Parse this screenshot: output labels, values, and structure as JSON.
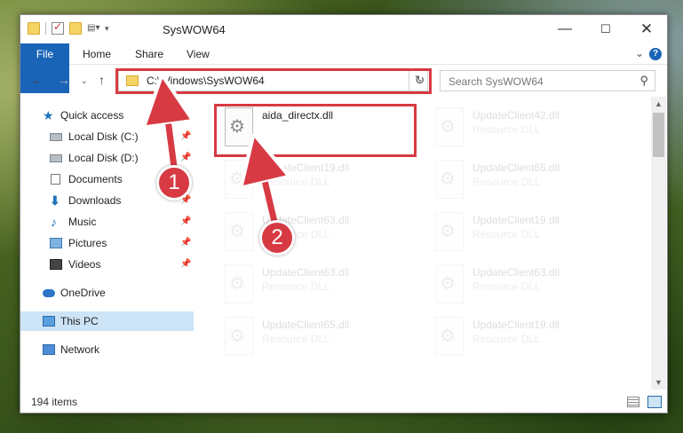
{
  "window": {
    "title": "SysWOW64",
    "minimize": "—",
    "maximize": "☐",
    "close": "✕"
  },
  "ribbon": {
    "tabs": [
      "File",
      "Home",
      "Share",
      "View"
    ],
    "expand": "⌄",
    "help": "?"
  },
  "address": {
    "path": "C:\\Windows\\SysWOW64",
    "dropdown": "⌄",
    "refresh": "↻"
  },
  "search": {
    "placeholder": "Search SysWOW64",
    "icon": "search-icon"
  },
  "nav_buttons": {
    "back": "←",
    "forward": "→",
    "recent": "⌄",
    "up": "↑"
  },
  "sidebar": {
    "items": [
      {
        "label": "Quick access",
        "icon": "star-icon"
      },
      {
        "label": "Local Disk (C:)",
        "icon": "drive-icon",
        "pinned": true
      },
      {
        "label": "Local Disk (D:)",
        "icon": "drive-icon",
        "pinned": true
      },
      {
        "label": "Documents",
        "icon": "documents-icon",
        "pinned": true
      },
      {
        "label": "Downloads",
        "icon": "downloads-icon",
        "pinned": true
      },
      {
        "label": "Music",
        "icon": "music-icon",
        "pinned": true
      },
      {
        "label": "Pictures",
        "icon": "pictures-icon",
        "pinned": true
      },
      {
        "label": "Videos",
        "icon": "videos-icon",
        "pinned": true
      },
      {
        "label": "OneDrive",
        "icon": "onedrive-icon"
      },
      {
        "label": "This PC",
        "icon": "pc-icon",
        "selected": true
      },
      {
        "label": "Network",
        "icon": "network-icon"
      }
    ],
    "pin_glyph": "📌"
  },
  "files": [
    {
      "name": "aida_directx.dll",
      "type": ""
    },
    {
      "name": "UpdateClient42.dll",
      "type": "Resource DLL"
    },
    {
      "name": "UpdateClient19.dll",
      "type": "Resource DLL"
    },
    {
      "name": "UpdateClient65.dll",
      "type": "Resource DLL"
    },
    {
      "name": "UpdateClient63.dll",
      "type": "Resource DLL"
    },
    {
      "name": "UpdateClient19.dll",
      "type": "Resource DLL"
    },
    {
      "name": "UpdateClient63.dll",
      "type": "Resource DLL"
    },
    {
      "name": "UpdateClient63.dll",
      "type": "Resource DLL"
    },
    {
      "name": "UpdateClient65.dll",
      "type": "Resource DLL"
    },
    {
      "name": "UpdateClient19.dll",
      "type": "Resource DLL"
    }
  ],
  "status": {
    "count": "194 items"
  },
  "callouts": [
    "1",
    "2"
  ],
  "colors": {
    "accent": "#1a64b8",
    "highlight": "#d73a43",
    "selection": "#cde4f7"
  }
}
